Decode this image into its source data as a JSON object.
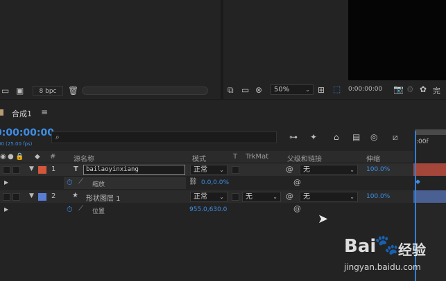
{
  "top_left_panel": {
    "bit_depth": "8 bpc"
  },
  "viewer": {
    "zoom": "50%",
    "timecode": "0:00:00:00",
    "complete_label": "完"
  },
  "comp_tab": {
    "label": "合成1"
  },
  "timeline": {
    "current_time": "0:00:00:00",
    "fps": "00 (25.00 fps)",
    "search_placeholder": "",
    "ruler_start": ":00f",
    "columns": {
      "num": "#",
      "source_name": "源名称",
      "mode": "模式",
      "t": "T",
      "trkmat": "TrkMat",
      "parent": "父级和链接",
      "stretch": "伸缩"
    },
    "layers": [
      {
        "index": "1",
        "type_icon": "T",
        "name": "bailaoyinxiang",
        "label_color": "#d4563b",
        "mode": "正常",
        "trkmat": "",
        "parent": "无",
        "stretch": "100.0%",
        "property": {
          "name": "缩放",
          "value": "0.0,0.0%"
        }
      },
      {
        "index": "2",
        "type_icon": "★",
        "name": "形状图层 1",
        "label_color": "#5a7ed6",
        "mode": "正常",
        "trkmat": "无",
        "parent": "无",
        "stretch": "100.0%",
        "property": {
          "name": "位置",
          "value": "955.0,630.0"
        }
      }
    ]
  },
  "watermark": {
    "brand": "Bai",
    "brand2": "经验",
    "url": "jingyan.baidu.com"
  },
  "colors": {
    "accent_blue": "#3d8ee6",
    "panel_bg": "#232323",
    "viewer_bg": "#050505",
    "playhead": "#2f7fd8"
  }
}
